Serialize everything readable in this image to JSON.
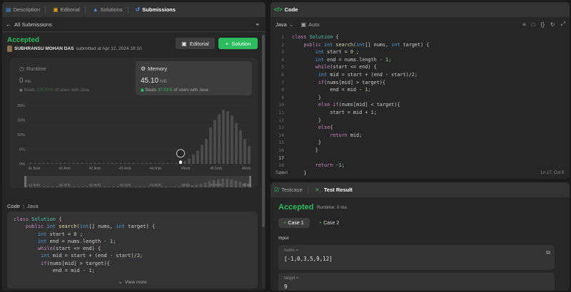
{
  "left_tabs": [
    {
      "label": "Description",
      "icon": "document-icon"
    },
    {
      "label": "Editorial",
      "icon": "book-icon"
    },
    {
      "label": "Solutions",
      "icon": "flask-icon"
    },
    {
      "label": "Submissions",
      "icon": "history-icon"
    }
  ],
  "back": {
    "label": "All Submissions"
  },
  "submission": {
    "status": "Accepted",
    "author": "SUBHRANSU MOHAN DAS",
    "submitted_text": "submitted at Apr 12, 2024 19:10",
    "editorial_label": "Editorial",
    "solution_label": "Solution"
  },
  "runtime": {
    "label": "Runtime",
    "value": "0",
    "unit": "ms",
    "beats_prefix": "Beats",
    "beats_pct": "100.00%",
    "beats_suffix": "of users with Java"
  },
  "memory": {
    "label": "Memory",
    "value": "45.10",
    "unit": "MB",
    "beats_prefix": "Beats",
    "beats_pct": "97.51%",
    "beats_suffix": "of users with Java"
  },
  "chart_data": {
    "type": "bar",
    "title": "",
    "xlabel": "",
    "ylabel": "",
    "ylim": [
      0,
      20
    ],
    "y_ticks": [
      "20%",
      "15%",
      "10%",
      "5%",
      "0%"
    ],
    "x_tick_labels": [
      "41.6mb",
      "42.4mb",
      "42.9mb",
      "43.4mb",
      "44.5mb",
      "45mb",
      "45.5mb",
      "46mb"
    ],
    "values": [
      0.3,
      0.3,
      0.3,
      0.3,
      0.3,
      0.3,
      0.3,
      0.3,
      0.3,
      0.3,
      0.3,
      0.3,
      0.3,
      0.3,
      0.3,
      0.3,
      0.3,
      0.3,
      0.3,
      0.3,
      0.3,
      0.3,
      0.3,
      0.3,
      0.3,
      0.3,
      0.3,
      0.3,
      0.3,
      0.3,
      0.3,
      0.3,
      0.3,
      0.3,
      0.3,
      0.4,
      1.0,
      1.8,
      3.2,
      4.5,
      6.5,
      8.5,
      12.5,
      15.0,
      17.0,
      18.5,
      18.0,
      16.5,
      14.0,
      11.5,
      8.5,
      6.0
    ],
    "highlight_index": 35,
    "grid": true
  },
  "code_header": {
    "title": "Code",
    "lang": "Java"
  },
  "submitted_code_lines": [
    "class Solution {",
    "    public int search(int[] nums, int target) {",
    "        int start = 0 ;",
    "        int end = nums.length - 1;",
    "        while(start <= end) {",
    "         int mid = start + (end - start)/2;",
    "         if(nums[mid] > target){",
    "             end = mid - 1;"
  ],
  "view_more_label": "View more",
  "code_panel": {
    "tab_label": "Code",
    "language": "Java",
    "mode": "Auto",
    "status_left": "Saved",
    "status_right": "Ln 17, Col 8"
  },
  "editor_line_numbers": [
    "1",
    "2",
    "3",
    "4",
    "5",
    "6",
    "7",
    "8",
    "9",
    "10",
    "11",
    "12",
    "13",
    "14",
    "15",
    "16",
    "17",
    "18",
    "19"
  ],
  "test_panel": {
    "testcase_tab": "Testcase",
    "result_tab": "Test Result",
    "status": "Accepted",
    "runtime_text": "Runtime: 0 ms",
    "cases": [
      "Case 1",
      "Case 2"
    ],
    "input_label": "Input",
    "vars": [
      {
        "name": "nums =",
        "value": "[-1,0,3,5,9,12]"
      },
      {
        "name": "target =",
        "value": "9"
      }
    ]
  },
  "colors": {
    "accent_green": "#2cbb5d",
    "panel": "#262626",
    "background": "#1a1a1a"
  }
}
